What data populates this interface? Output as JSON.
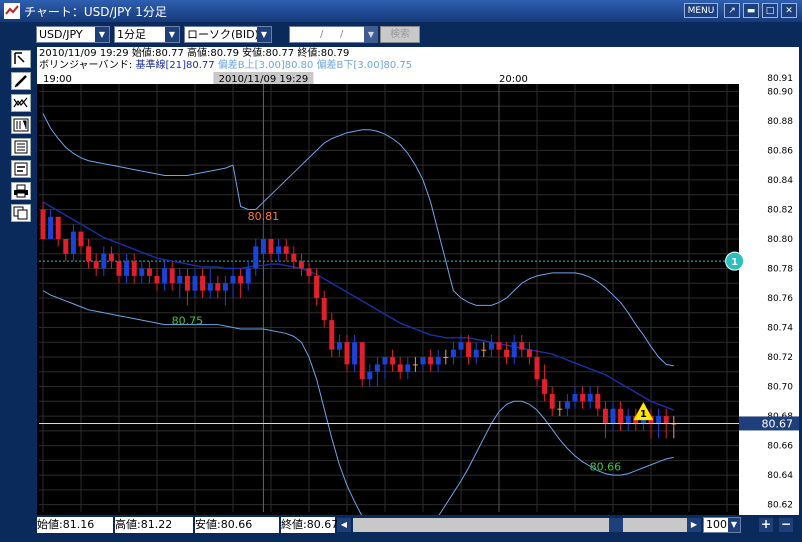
{
  "window": {
    "title": "チャート：USD/JPY 1分足",
    "menu_label": "MENU"
  },
  "toolbar": {
    "pair": "USD/JPY",
    "timeframe": "1分足",
    "chart_kind": "ローソク(BID)",
    "date_sep1": "/",
    "date_sep2": "/",
    "search_label": "検索"
  },
  "info": {
    "line1": "2010/11/09 19:29 始値:80.77 高値:80.79 安値:80.77 終値:80.79",
    "bb_name": "ボリンジャーバンド:",
    "bb_mid": "基準線[21]80.77",
    "bb_up": "偏差B上[3.00]80.80",
    "bb_dn": "偏差B下[3.00]80.75"
  },
  "chart_data": {
    "type": "candlestick",
    "time_labels": [
      {
        "text": "19:00",
        "idx": 0
      },
      {
        "text": "20:00",
        "idx": 60
      }
    ],
    "cursor_label": "2010/11/09 19:29",
    "cursor_idx": 29,
    "y_ticks": [
      "80.90",
      "80.88",
      "80.86",
      "80.84",
      "80.82",
      "80.80",
      "80.78",
      "80.76",
      "80.74",
      "80.72",
      "80.70",
      "80.68",
      "80.66",
      "80.64",
      "80.62"
    ],
    "y_top_clip": "80.91",
    "ylim": [
      80.615,
      80.905
    ],
    "current_price": "80.67",
    "current_price_value": 80.675,
    "dashed_level": 80.785,
    "annotations": [
      {
        "text": "80.81",
        "idx": 29,
        "value": 80.813,
        "color": "#ff7a3a"
      },
      {
        "text": "80.75",
        "idx": 19,
        "value": 80.742,
        "color": "#3fc43f"
      },
      {
        "text": "80.66",
        "idx": 74,
        "value": 80.643,
        "color": "#3fc43f"
      }
    ],
    "markers": [
      {
        "text": "1",
        "kind": "circle",
        "idx": 91,
        "value": 80.785,
        "color": "#2bbfbf"
      },
      {
        "text": "1",
        "kind": "triangle",
        "idx": 79,
        "value": 80.682,
        "color": "#ffe800"
      }
    ],
    "candles": [
      [
        80.82,
        80.825,
        80.8,
        80.8
      ],
      [
        80.8,
        80.82,
        80.8,
        80.815
      ],
      [
        80.815,
        80.815,
        80.795,
        80.8
      ],
      [
        80.8,
        80.8,
        80.785,
        80.79
      ],
      [
        80.79,
        80.81,
        80.785,
        80.805
      ],
      [
        80.805,
        80.805,
        80.79,
        80.795
      ],
      [
        80.795,
        80.8,
        80.78,
        80.785
      ],
      [
        80.785,
        80.79,
        80.775,
        80.78
      ],
      [
        80.78,
        80.795,
        80.775,
        80.79
      ],
      [
        80.79,
        80.795,
        80.78,
        80.785
      ],
      [
        80.785,
        80.79,
        80.77,
        80.775
      ],
      [
        80.775,
        80.79,
        80.77,
        80.785
      ],
      [
        80.785,
        80.79,
        80.77,
        80.775
      ],
      [
        80.775,
        80.785,
        80.77,
        80.78
      ],
      [
        80.78,
        80.785,
        80.77,
        80.775
      ],
      [
        80.775,
        80.78,
        80.765,
        80.77
      ],
      [
        80.77,
        80.785,
        80.765,
        80.78
      ],
      [
        80.78,
        80.785,
        80.765,
        80.77
      ],
      [
        80.77,
        80.78,
        80.76,
        80.775
      ],
      [
        80.775,
        80.78,
        80.755,
        80.765
      ],
      [
        80.765,
        80.78,
        80.76,
        80.775
      ],
      [
        80.775,
        80.78,
        80.76,
        80.765
      ],
      [
        80.765,
        80.78,
        80.76,
        80.77
      ],
      [
        80.77,
        80.775,
        80.76,
        80.765
      ],
      [
        80.765,
        80.775,
        80.755,
        80.77
      ],
      [
        80.77,
        80.78,
        80.76,
        80.775
      ],
      [
        80.775,
        80.78,
        80.76,
        80.77
      ],
      [
        80.77,
        80.785,
        80.765,
        80.78
      ],
      [
        80.78,
        80.8,
        80.775,
        80.795
      ],
      [
        80.79,
        80.81,
        80.785,
        80.8
      ],
      [
        80.8,
        80.8,
        80.785,
        80.79
      ],
      [
        80.79,
        80.8,
        80.785,
        80.795
      ],
      [
        80.795,
        80.8,
        80.785,
        80.79
      ],
      [
        80.79,
        80.795,
        80.78,
        80.785
      ],
      [
        80.785,
        80.79,
        80.775,
        80.78
      ],
      [
        80.78,
        80.785,
        80.77,
        80.775
      ],
      [
        80.775,
        80.78,
        80.755,
        80.76
      ],
      [
        80.76,
        80.765,
        80.74,
        80.745
      ],
      [
        80.745,
        80.75,
        80.72,
        80.725
      ],
      [
        80.725,
        80.735,
        80.72,
        80.73
      ],
      [
        80.73,
        80.735,
        80.71,
        80.715
      ],
      [
        80.715,
        80.735,
        80.71,
        80.73
      ],
      [
        80.73,
        80.73,
        80.7,
        80.705
      ],
      [
        80.705,
        80.715,
        80.7,
        80.71
      ],
      [
        80.71,
        80.72,
        80.7,
        80.715
      ],
      [
        80.715,
        80.72,
        80.705,
        80.72
      ],
      [
        80.72,
        80.725,
        80.71,
        80.715
      ],
      [
        80.715,
        80.72,
        80.705,
        80.71
      ],
      [
        80.71,
        80.72,
        80.705,
        80.715
      ],
      [
        80.715,
        80.72,
        80.71,
        80.715
      ],
      [
        80.715,
        80.72,
        80.71,
        80.72
      ],
      [
        80.72,
        80.725,
        80.71,
        80.715
      ],
      [
        80.715,
        80.725,
        80.71,
        80.72
      ],
      [
        80.72,
        80.725,
        80.715,
        80.72
      ],
      [
        80.72,
        80.73,
        80.715,
        80.725
      ],
      [
        80.725,
        80.735,
        80.72,
        80.73
      ],
      [
        80.73,
        80.735,
        80.715,
        80.72
      ],
      [
        80.72,
        80.73,
        80.715,
        80.725
      ],
      [
        80.725,
        80.73,
        80.72,
        80.725
      ],
      [
        80.725,
        80.735,
        80.72,
        80.73
      ],
      [
        80.73,
        80.735,
        80.72,
        80.725
      ],
      [
        80.725,
        80.73,
        80.715,
        80.72
      ],
      [
        80.72,
        80.735,
        80.715,
        80.73
      ],
      [
        80.73,
        80.735,
        80.72,
        80.725
      ],
      [
        80.725,
        80.73,
        80.715,
        80.72
      ],
      [
        80.72,
        80.725,
        80.7,
        80.705
      ],
      [
        80.705,
        80.715,
        80.69,
        80.695
      ],
      [
        80.695,
        80.7,
        80.68,
        80.685
      ],
      [
        80.685,
        80.69,
        80.68,
        80.685
      ],
      [
        80.685,
        80.695,
        80.68,
        80.69
      ],
      [
        80.69,
        80.7,
        80.685,
        80.695
      ],
      [
        80.695,
        80.7,
        80.685,
        80.69
      ],
      [
        80.69,
        80.7,
        80.685,
        80.695
      ],
      [
        80.695,
        80.7,
        80.68,
        80.685
      ],
      [
        80.685,
        80.69,
        80.665,
        80.675
      ],
      [
        80.675,
        80.69,
        80.67,
        80.685
      ],
      [
        80.685,
        80.69,
        80.67,
        80.675
      ],
      [
        80.675,
        80.685,
        80.67,
        80.68
      ],
      [
        80.68,
        80.685,
        80.67,
        80.675
      ],
      [
        80.675,
        80.685,
        80.67,
        80.68
      ],
      [
        80.68,
        80.685,
        80.665,
        80.675
      ],
      [
        80.675,
        80.685,
        80.665,
        80.68
      ],
      [
        80.68,
        80.685,
        80.665,
        80.675
      ],
      [
        80.675,
        80.68,
        80.665,
        80.675
      ]
    ],
    "bb_mid": [
      80.825,
      80.822,
      80.819,
      80.816,
      80.813,
      80.81,
      80.807,
      80.804,
      80.801,
      80.799,
      80.797,
      80.795,
      80.793,
      80.791,
      80.789,
      80.787,
      80.786,
      80.785,
      80.784,
      80.783,
      80.782,
      80.781,
      80.781,
      80.781,
      80.78,
      80.78,
      80.78,
      80.781,
      80.782,
      80.782,
      80.783,
      80.783,
      80.782,
      80.781,
      80.78,
      80.778,
      80.776,
      80.773,
      80.77,
      80.767,
      80.764,
      80.761,
      80.758,
      80.755,
      80.752,
      80.749,
      80.746,
      80.743,
      80.741,
      80.739,
      80.737,
      80.735,
      80.734,
      80.733,
      80.733,
      80.733,
      80.733,
      80.732,
      80.731,
      80.73,
      80.729,
      80.728,
      80.727,
      80.726,
      80.725,
      80.724,
      80.723,
      80.722,
      80.72,
      80.718,
      80.716,
      80.714,
      80.712,
      80.71,
      80.708,
      80.705,
      80.702,
      80.699,
      80.696,
      80.693,
      80.69,
      80.688,
      80.686,
      80.684
    ],
    "bb_up": [
      80.885,
      80.875,
      80.868,
      80.862,
      80.858,
      80.855,
      80.853,
      80.852,
      80.851,
      80.85,
      80.849,
      80.848,
      80.847,
      80.846,
      80.845,
      80.844,
      80.843,
      80.843,
      80.843,
      80.843,
      80.844,
      80.845,
      80.846,
      80.847,
      80.848,
      80.85,
      80.822,
      80.82,
      80.82,
      80.825,
      80.83,
      80.835,
      80.84,
      80.845,
      80.85,
      80.855,
      80.86,
      80.865,
      80.868,
      80.87,
      80.872,
      80.873,
      80.874,
      80.874,
      80.873,
      80.871,
      80.868,
      80.864,
      80.858,
      80.85,
      80.84,
      80.825,
      80.805,
      80.785,
      80.765,
      80.76,
      80.757,
      80.755,
      80.755,
      80.755,
      80.757,
      80.76,
      80.765,
      80.77,
      80.773,
      80.775,
      80.776,
      80.777,
      80.777,
      80.777,
      80.777,
      80.776,
      80.774,
      80.771,
      80.767,
      80.762,
      80.757,
      80.75,
      80.742,
      80.735,
      80.727,
      80.72,
      80.715,
      80.714
    ],
    "bb_dn": [
      80.765,
      80.762,
      80.76,
      80.758,
      80.756,
      80.754,
      80.752,
      80.751,
      80.75,
      80.749,
      80.748,
      80.747,
      80.746,
      80.745,
      80.744,
      80.743,
      80.742,
      80.742,
      80.742,
      80.742,
      80.742,
      80.742,
      80.742,
      80.742,
      80.741,
      80.74,
      80.739,
      80.739,
      80.739,
      80.739,
      80.738,
      80.737,
      80.736,
      80.734,
      80.73,
      80.72,
      80.705,
      80.685,
      80.665,
      80.647,
      80.633,
      80.622,
      80.612,
      80.604,
      80.598,
      80.594,
      80.592,
      80.592,
      80.594,
      80.597,
      80.601,
      80.606,
      80.612,
      80.62,
      80.628,
      80.636,
      80.645,
      80.655,
      80.665,
      80.675,
      80.683,
      80.688,
      80.69,
      80.69,
      80.688,
      80.684,
      80.678,
      80.671,
      80.664,
      80.658,
      80.653,
      80.649,
      80.646,
      80.643,
      80.641,
      80.64,
      80.64,
      80.641,
      80.643,
      80.645,
      80.647,
      80.649,
      80.651,
      80.652
    ]
  },
  "status": {
    "open": "始値:81.16",
    "high": "高値:81.22",
    "low": "安値:80.66",
    "close": "終値:80.67",
    "zoom": "100"
  },
  "colors": {
    "up": "#1a44d8",
    "down": "#e0202c",
    "doji": "#f0a040",
    "bb_outer": "#6fa4e8",
    "bb_mid": "#1c2fa8",
    "grid": "#2c2c2c",
    "price_line": "#f0d890"
  }
}
